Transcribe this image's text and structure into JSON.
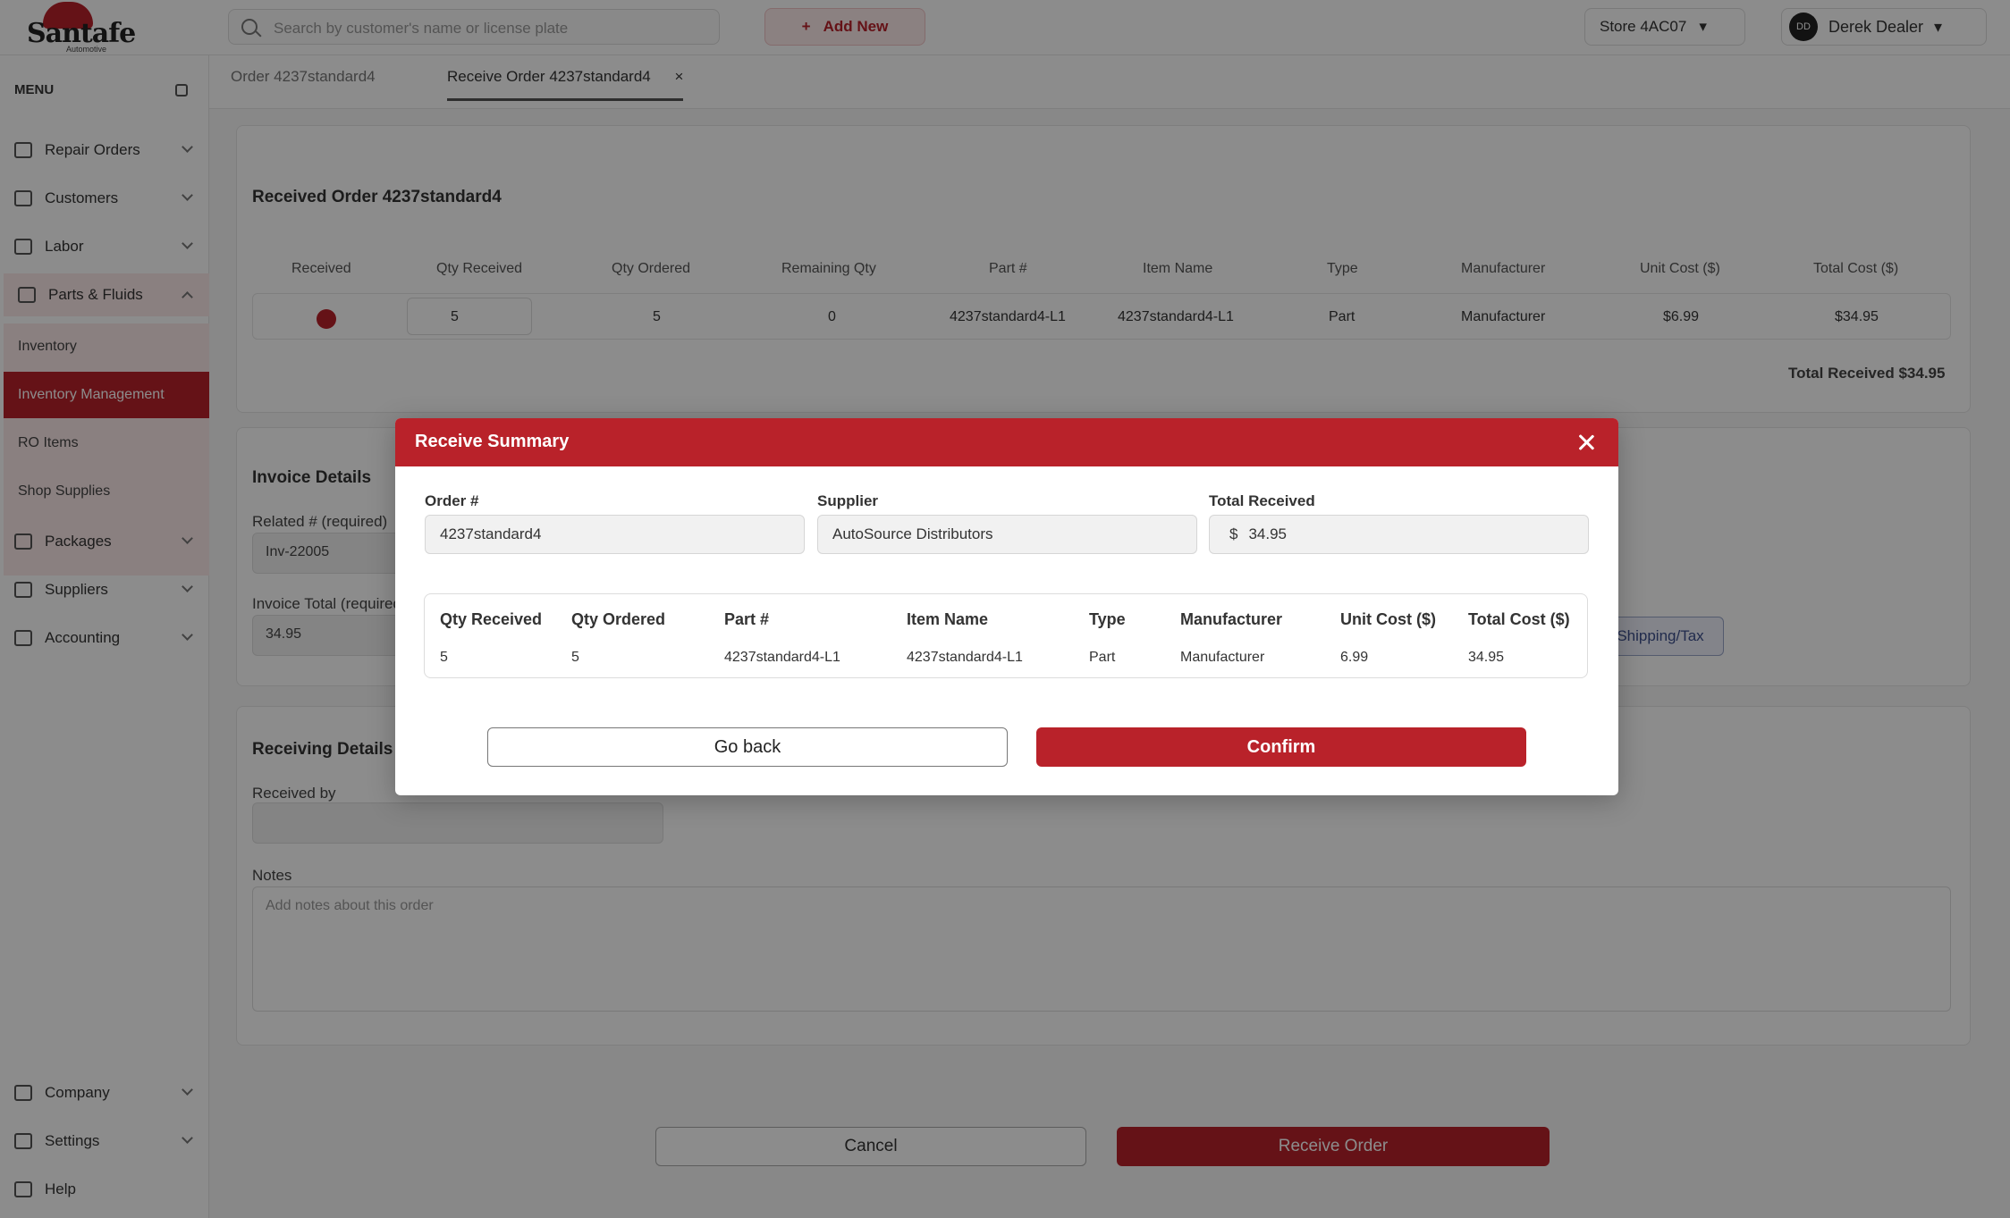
{
  "header": {
    "logo_text": "Santafe",
    "logo_sub": "Automotive",
    "search_placeholder": "Search by customer's name or license plate",
    "add_new_label": "Add New",
    "store_label": "Store 4AC07",
    "user_initials": "DD",
    "user_name": "Derek Dealer"
  },
  "sidebar": {
    "title": "MENU",
    "items_top": [
      {
        "label": "Repair Orders"
      },
      {
        "label": "Customers"
      },
      {
        "label": "Labor"
      },
      {
        "label": "Parts & Fluids"
      }
    ],
    "sub_items": [
      {
        "label": "Inventory"
      },
      {
        "label": "Inventory Management"
      },
      {
        "label": "RO Items"
      },
      {
        "label": "Shop Supplies"
      }
    ],
    "items_bottom": [
      {
        "label": "Packages"
      },
      {
        "label": "Suppliers"
      },
      {
        "label": "Accounting"
      }
    ],
    "footer_items": [
      {
        "label": "Company"
      },
      {
        "label": "Settings"
      },
      {
        "label": "Help"
      }
    ]
  },
  "tabs": [
    {
      "label": "Order 4237standard4"
    },
    {
      "label": "Receive Order 4237standard4"
    }
  ],
  "background": {
    "received_title": "Received Order 4237standard4",
    "columns": [
      "Received",
      "Qty Received",
      "Qty Ordered",
      "Remaining Qty",
      "Part #",
      "Item Name",
      "Type",
      "Manufacturer",
      "Unit Cost ($)",
      "Total Cost ($)"
    ],
    "row": [
      "",
      "5",
      "5",
      "0",
      "4237standard4-L1",
      "4237standard4-L1",
      "Part",
      "Manufacturer",
      "$6.99",
      "$34.95"
    ],
    "total_received": "Total Received $34.95",
    "invoice_title": "Invoice Details",
    "invoice_label": "Related # (required)",
    "invoice_value": "Inv-22005",
    "invoice_total_label": "Invoice Total (required)",
    "invoice_total_value": "34.95",
    "shipping_button": "Shipping/Tax",
    "receiving_title": "Receiving Details",
    "received_by_label": "Received by",
    "notes_label": "Notes",
    "notes_placeholder": "Add notes about this order",
    "cancel_button": "Cancel",
    "receive_button": "Receive Order"
  },
  "modal": {
    "title": "Receive Summary",
    "order_label": "Order #",
    "order_value": "4237standard4",
    "supplier_label": "Supplier",
    "supplier_value": "AutoSource Distributors",
    "total_label": "Total Received",
    "total_prefix": "$",
    "total_value": "34.95",
    "table": {
      "headers": [
        "Qty Received",
        "Qty Ordered",
        "Part #",
        "Item Name",
        "Type",
        "Manufacturer",
        "Unit Cost ($)",
        "Total Cost ($)"
      ],
      "row": [
        "5",
        "5",
        "4237standard4-L1",
        "4237standard4-L1",
        "Part",
        "Manufacturer",
        "6.99",
        "34.95"
      ]
    },
    "go_back_label": "Go back",
    "confirm_label": "Confirm"
  },
  "colors": {
    "brand": "#b9222a",
    "overlay": "rgba(0,0,0,0.45)"
  }
}
